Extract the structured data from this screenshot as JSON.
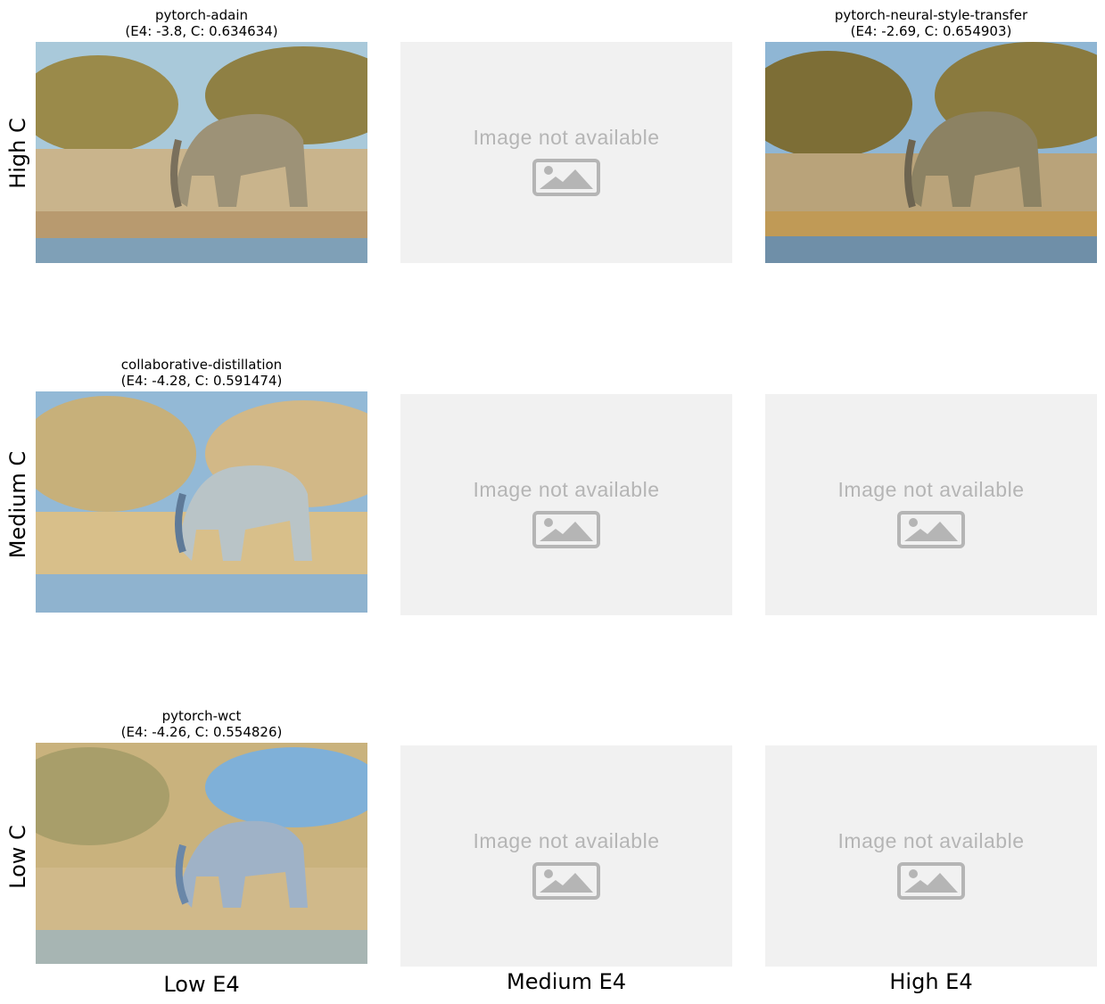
{
  "grid": {
    "row_labels": [
      "High C",
      "Medium C",
      "Low C"
    ],
    "col_labels": [
      "Low E4",
      "Medium E4",
      "High E4"
    ],
    "placeholder_text": "Image not available",
    "cells": {
      "high_low": {
        "name": "pytorch-adain",
        "metrics": "(E4: -3.8, C: 0.634634)"
      },
      "high_high": {
        "name": "pytorch-neural-style-transfer",
        "metrics": "(E4: -2.69, C: 0.654903)"
      },
      "medium_low": {
        "name": "collaborative-distillation",
        "metrics": "(E4: -4.28, C: 0.591474)"
      },
      "low_low": {
        "name": "pytorch-wct",
        "metrics": "(E4: -4.26, C: 0.554826)"
      }
    }
  },
  "icons": {
    "placeholder": "image-placeholder-icon"
  },
  "colors": {
    "placeholder_bg": "#f1f1f1",
    "placeholder_fg": "#b5b5b5"
  }
}
